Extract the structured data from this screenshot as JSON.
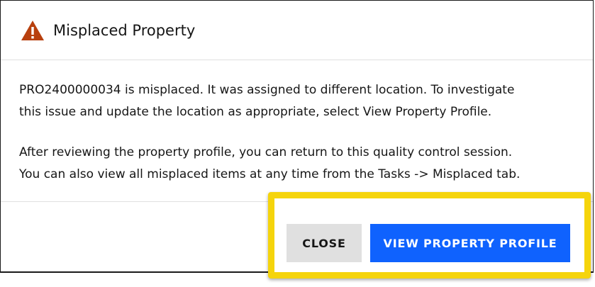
{
  "dialog": {
    "title": "Misplaced Property",
    "icon": "warning-icon",
    "icon_color": "#b8400e",
    "paragraph1_line1": "PRO2400000034 is misplaced. It was assigned to different location. To investigate",
    "paragraph1_line2": "this issue and update the location as appropriate, select View Property Profile.",
    "paragraph2_line1": "After reviewing the property profile, you can return to this quality control session.",
    "paragraph2_line2": "You can also view all misplaced items at any time from the Tasks -> Misplaced tab."
  },
  "actions": {
    "close_label": "CLOSE",
    "view_profile_label": "VIEW PROPERTY PROFILE"
  },
  "colors": {
    "primary": "#0f62fe",
    "secondary": "#e0e0e0",
    "highlight": "#f5d40c"
  }
}
